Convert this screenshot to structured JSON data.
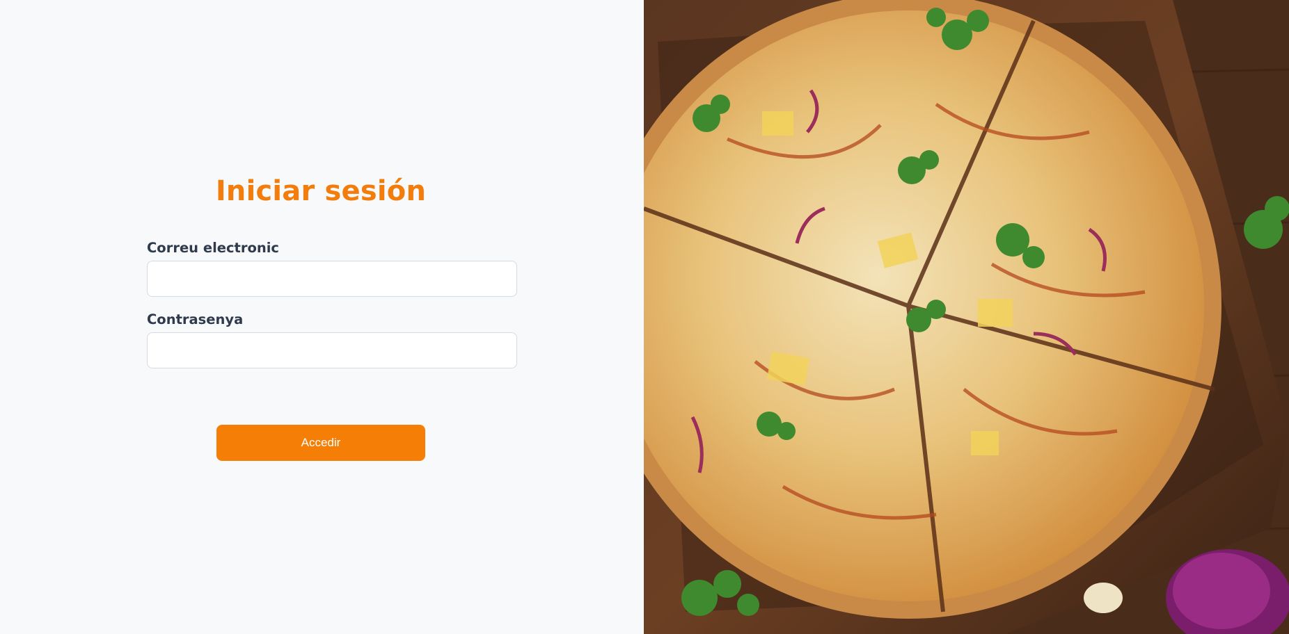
{
  "login": {
    "title": "Iniciar sesión",
    "email_label": "Correu electronic",
    "email_value": "",
    "password_label": "Contrasenya",
    "password_value": "",
    "submit_label": "Accedir"
  },
  "hero_image": {
    "icon": "pizza-photo"
  },
  "colors": {
    "accent": "#f57f06",
    "title": "#f27d0c",
    "label": "#2f3a4c",
    "background": "#f8f9fb"
  }
}
